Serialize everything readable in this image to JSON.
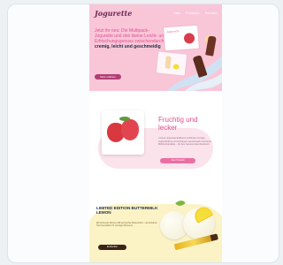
{
  "brand": "Jogurette",
  "nav": [
    "Idee",
    "Produkte",
    "Kontakt"
  ],
  "hero": {
    "text_pink": "Jetzt ihr neu: Die Multipack-Jogurette und drei kleine Leicht- und Erfrischungsgenuss zwischendurch",
    "text_bold": "cremig, leicht und geschmeidig",
    "button": "Mehr erfahren",
    "pack_brand": "Jogurette"
  },
  "strawberry": {
    "title": "Fruchtig und lecker",
    "body": "Unsere Jogurette Erdbeere verbindet cremige Joghurtfüllung mit fruchtigem Geschmack und feiner Milchschokolade – für den Genuss zwischendurch.",
    "button": "Zum Produkt"
  },
  "lemon": {
    "title": "LIMITED EDITION BUTTERMILK LEMON",
    "body": "Erfrischende Zitrone trifft auf leichte Buttermilch – die limitierte Sommeredition für sonnige Momente.",
    "button": "Entdecken"
  },
  "colors": {
    "hero_bg": "#f9c6d8",
    "pink_accent": "#e2508f",
    "lemon_bg": "#fbf3c6"
  }
}
